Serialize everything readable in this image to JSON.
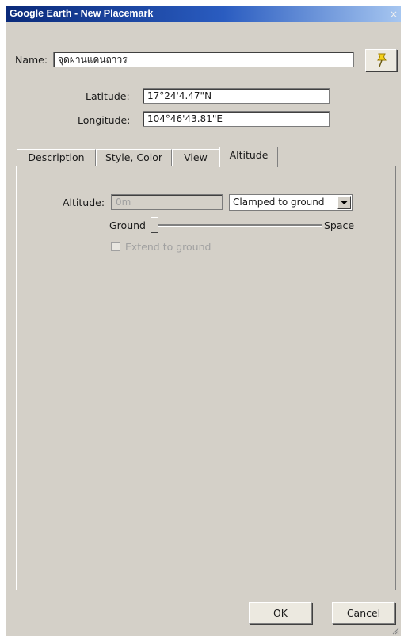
{
  "window": {
    "title": "Google Earth - New Placemark",
    "close_glyph": "×"
  },
  "name_field": {
    "label": "Name:",
    "value": "จุดผ่านแดนถาวร"
  },
  "pin_button": {
    "icon": "yellow-pushpin-icon"
  },
  "latitude": {
    "label": "Latitude:",
    "value": "17°24'4.47\"N"
  },
  "longitude": {
    "label": "Longitude:",
    "value": "104°46'43.81\"E"
  },
  "tabs": [
    {
      "label": "Description"
    },
    {
      "label": "Style, Color"
    },
    {
      "label": "View"
    },
    {
      "label": "Altitude",
      "active": true
    }
  ],
  "altitude": {
    "label": "Altitude:",
    "value": "0m",
    "mode_selected": "Clamped to ground",
    "slider_left_label": "Ground",
    "slider_right_label": "Space",
    "slider_level": 0,
    "extend_label": "Extend to ground",
    "extend_checked": false
  },
  "buttons": {
    "ok": "OK",
    "cancel": "Cancel"
  },
  "colors": {
    "titlebar_start": "#0a2a7a",
    "titlebar_end": "#a6c6f0",
    "dialog_bg": "#d4d0c8",
    "disabled_text": "#a0a0a0"
  }
}
